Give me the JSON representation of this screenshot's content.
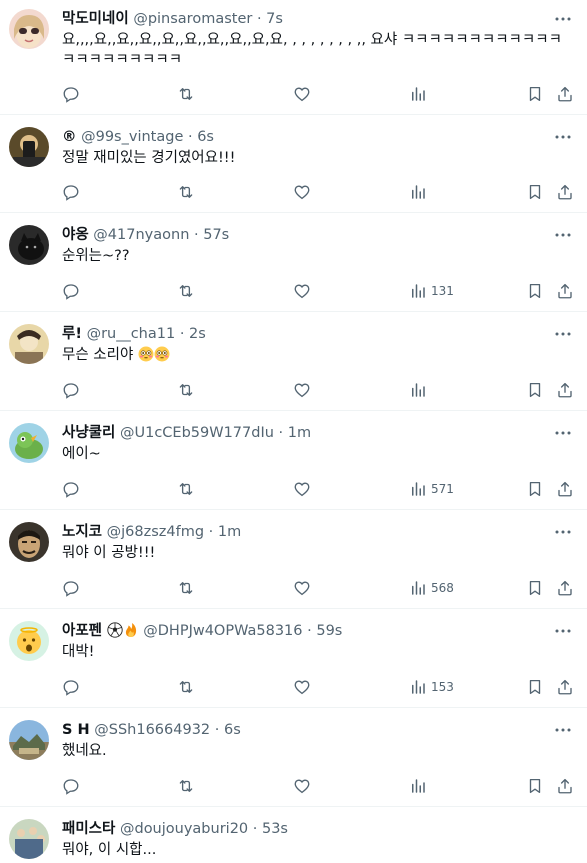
{
  "tweets": [
    {
      "name": "막도미네이",
      "handle": "@pinsaromaster",
      "dot": "·",
      "time": "7s",
      "text": "요,,,,요,,요,,요,,요,,요,,요,,요,,요,요, , , , , , , , ,, 요샤 ㅋㅋㅋㅋㅋㅋㅋㅋㅋㅋㅋㅋㅋㅋㅋㅋㅋㅋㅋㅋㅋ",
      "views": ""
    },
    {
      "name": "®",
      "handle": "@99s_vintage",
      "dot": "·",
      "time": "6s",
      "text": "정말 재미있는 경기였어요!!!",
      "views": ""
    },
    {
      "name": "야옹",
      "handle": "@417nyaonn",
      "dot": "·",
      "time": "57s",
      "text": "순위는~??",
      "views": "131"
    },
    {
      "name": "루!",
      "handle": "@ru__cha11",
      "dot": "·",
      "time": "2s",
      "text": "무슨 소리야",
      "views": ""
    },
    {
      "name": "사냥쿨리",
      "handle": "@U1cCEb59W177dIu",
      "dot": "·",
      "time": "1m",
      "text": "에이~",
      "views": "571"
    },
    {
      "name": "노지코",
      "handle": "@j68zsz4fmg",
      "dot": "·",
      "time": "1m",
      "text": "뭐야 이 공방!!!",
      "views": "568"
    },
    {
      "name": "아포펜",
      "handle": "@DHPJw4OPWa58316",
      "dot": "·",
      "time": "59s",
      "text": "대박!",
      "views": "153"
    },
    {
      "name": "S H",
      "handle": "@SSh16664932",
      "dot": "·",
      "time": "6s",
      "text": "했네요.",
      "views": ""
    },
    {
      "name": "패미스타",
      "handle": "@doujouyaburi20",
      "dot": "·",
      "time": "53s",
      "text": "뭐야, 이 시합...",
      "views": ""
    }
  ],
  "colors": {
    "text": "#0f1419",
    "secondary": "#536471",
    "divider": "#eff3f4"
  },
  "icons": [
    "more-icon",
    "reply-icon",
    "retweet-icon",
    "like-icon",
    "views-icon",
    "bookmark-icon",
    "share-icon",
    "flushed-emoji-icon",
    "soccer-ball-icon",
    "fire-icon"
  ]
}
